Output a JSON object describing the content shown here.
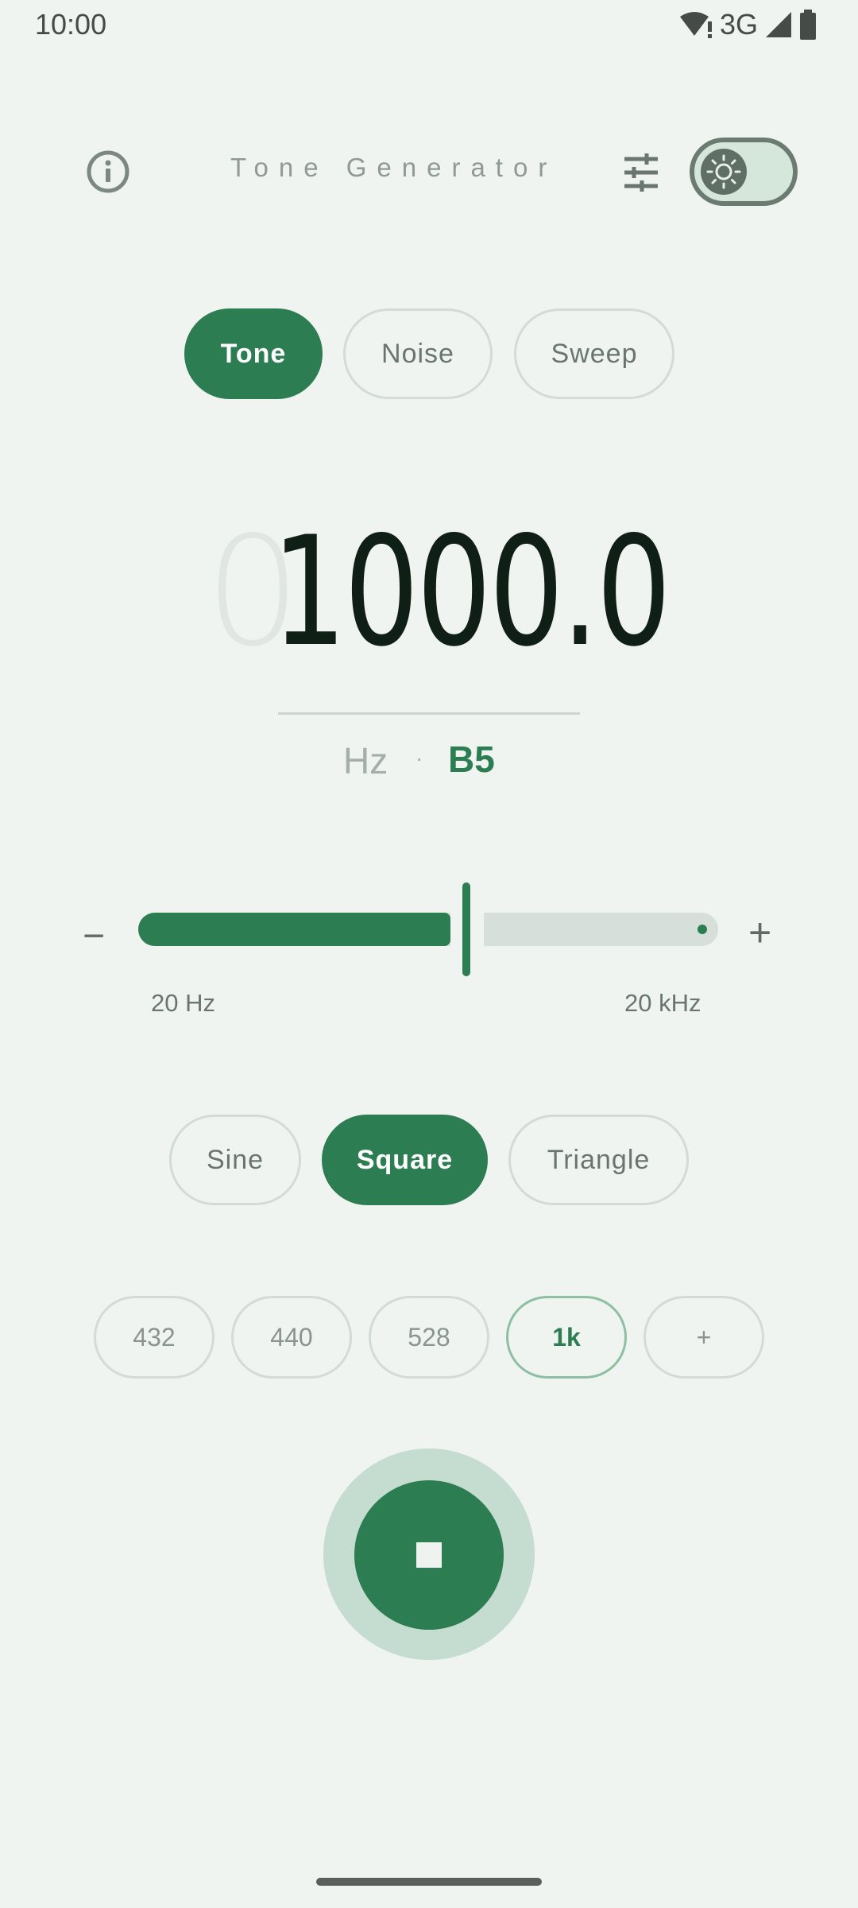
{
  "status_bar": {
    "time": "10:00",
    "network": "3G",
    "icons": [
      "wifi-alert-icon",
      "signal-icon",
      "battery-icon"
    ]
  },
  "header": {
    "title": "Tone Generator",
    "info_icon": "info-icon",
    "settings_icon": "tune-sliders-icon",
    "theme_icon": "sun-icon",
    "theme_toggle_on": false
  },
  "modes": [
    {
      "label": "Tone",
      "active": true
    },
    {
      "label": "Noise",
      "active": false
    },
    {
      "label": "Sweep",
      "active": false
    }
  ],
  "frequency": {
    "leading_ghost": "0",
    "value": "1000.0",
    "unit": "Hz",
    "separator": "·",
    "note": "B5"
  },
  "slider": {
    "minus_label": "−",
    "plus_label": "+",
    "min_label": "20 Hz",
    "max_label": "20 kHz",
    "position_fraction": 0.57
  },
  "waveforms": [
    {
      "label": "Sine",
      "active": false
    },
    {
      "label": "Square",
      "active": true
    },
    {
      "label": "Triangle",
      "active": false
    }
  ],
  "presets": [
    {
      "label": "432",
      "selected": false
    },
    {
      "label": "440",
      "selected": false
    },
    {
      "label": "528",
      "selected": false
    },
    {
      "label": "1k",
      "selected": true
    },
    {
      "label": "+",
      "selected": false
    }
  ],
  "playback": {
    "state": "playing",
    "icon": "stop-icon"
  },
  "colors": {
    "accent": "#2d7d52",
    "background": "#eff4f0",
    "halo": "#c5ddd0"
  }
}
